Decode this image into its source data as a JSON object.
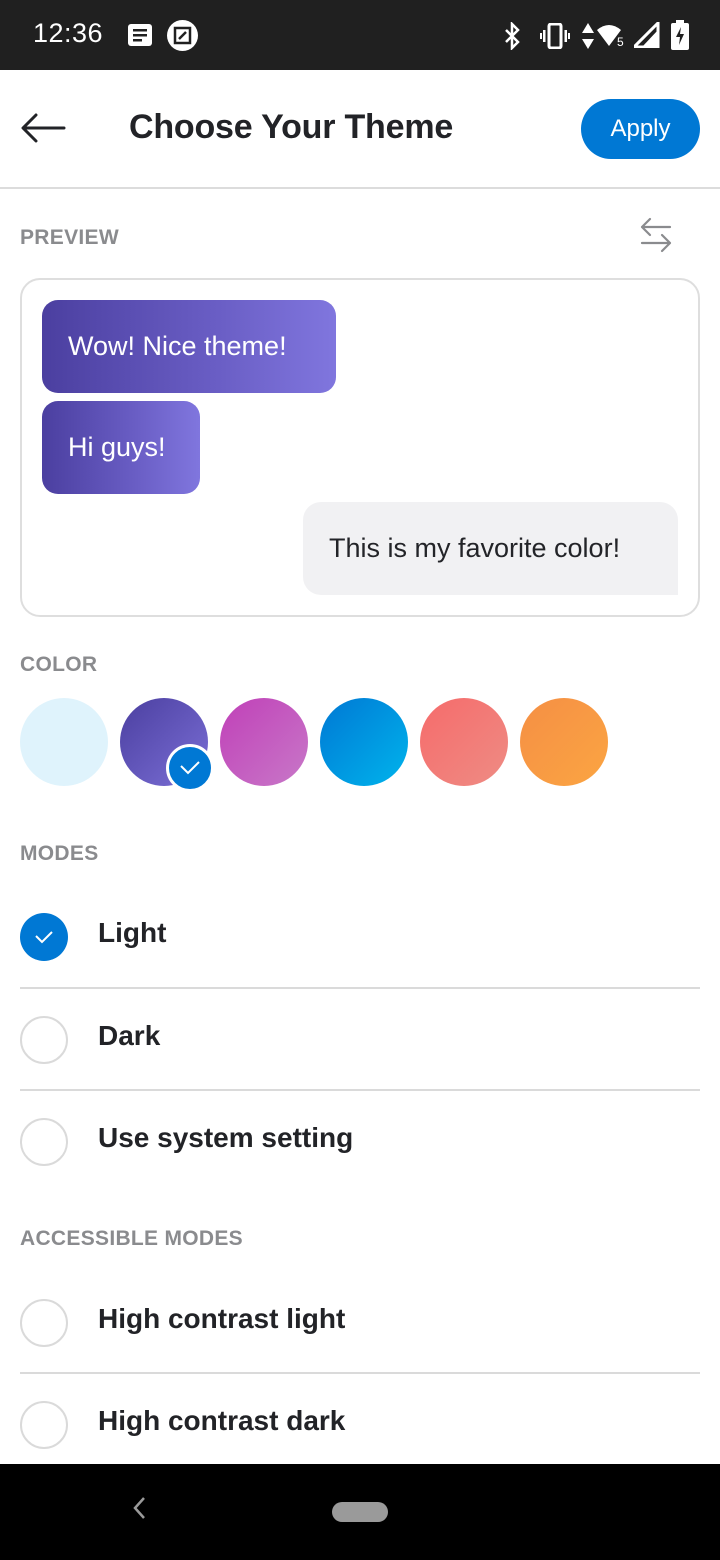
{
  "status_bar": {
    "time": "12:36",
    "left_icons": [
      "notes-icon",
      "screenshot-edit-icon"
    ],
    "right_icons": [
      "bluetooth-icon",
      "vibrate-icon",
      "data-arrows-icon",
      "wifi-icon",
      "signal-icon",
      "battery-charging-icon"
    ],
    "wifi_badge": "5"
  },
  "app_bar": {
    "back_icon": "arrow-left-icon",
    "title": "Choose Your Theme",
    "apply_label": "Apply"
  },
  "preview": {
    "label": "PREVIEW",
    "swap_icon": "swap-arrows-icon",
    "messages": [
      {
        "text": "Wow! Nice theme!",
        "type": "sent"
      },
      {
        "text": "Hi guys!",
        "type": "sent"
      },
      {
        "text": "This is my favorite color!",
        "type": "received"
      }
    ]
  },
  "color": {
    "label": "COLOR",
    "selected_index": 1,
    "swatches": [
      {
        "name": "light-blue",
        "from": "#dff3fc",
        "to": "#dff3fc"
      },
      {
        "name": "purple",
        "from": "#4b3fa0",
        "to": "#7b6fd6"
      },
      {
        "name": "magenta",
        "from": "#c040b8",
        "to": "#c878c8"
      },
      {
        "name": "blue",
        "from": "#0078d4",
        "to": "#00b4ec"
      },
      {
        "name": "coral",
        "from": "#f66b6b",
        "to": "#ee8c84"
      },
      {
        "name": "orange",
        "from": "#f58f45",
        "to": "#fba542"
      }
    ]
  },
  "modes": {
    "label": "MODES",
    "options": [
      {
        "label": "Light",
        "checked": true
      },
      {
        "label": "Dark",
        "checked": false
      },
      {
        "label": "Use system setting",
        "checked": false
      }
    ]
  },
  "accessible_modes": {
    "label": "ACCESSIBLE MODES",
    "options": [
      {
        "label": "High contrast light",
        "checked": false
      },
      {
        "label": "High contrast dark",
        "checked": false
      }
    ]
  },
  "colors": {
    "accent": "#0078d4",
    "text_primary": "#222327",
    "text_secondary": "#8a8b8e",
    "divider": "#dadada"
  }
}
